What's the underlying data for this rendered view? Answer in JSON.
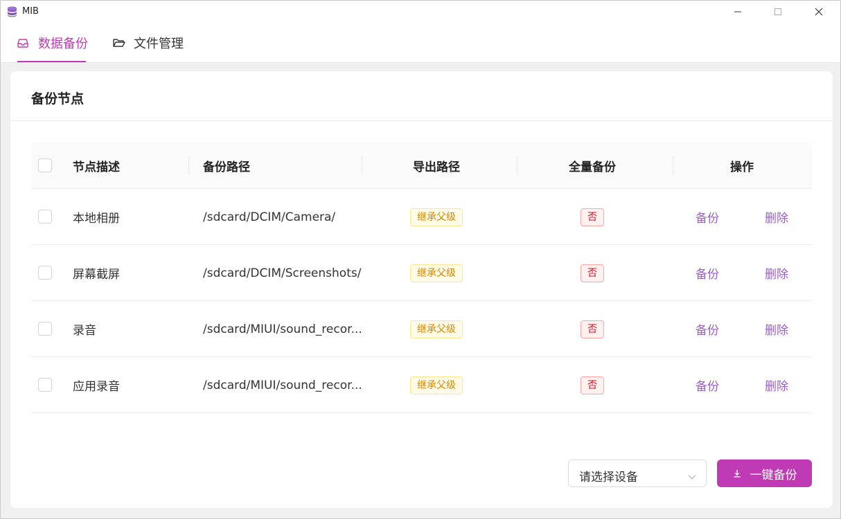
{
  "window": {
    "title": "MIB",
    "app_icon": "database-icon",
    "controls": {
      "minimize": "minimize-icon",
      "maximize": "maximize-icon",
      "close": "close-icon"
    }
  },
  "tabs": [
    {
      "label": "数据备份",
      "icon": "inbox-icon",
      "active": true
    },
    {
      "label": "文件管理",
      "icon": "folder-open-icon",
      "active": false
    }
  ],
  "card": {
    "title": "备份节点"
  },
  "table": {
    "columns": [
      "节点描述",
      "备份路径",
      "导出路径",
      "全量备份",
      "操作"
    ],
    "rows": [
      {
        "desc": "本地相册",
        "path": "/sdcard/DCIM/Camera/",
        "export": "继承父级",
        "full": "否",
        "op_backup": "备份",
        "op_delete": "删除"
      },
      {
        "desc": "屏幕截屏",
        "path": "/sdcard/DCIM/Screenshots/",
        "export": "继承父级",
        "full": "否",
        "op_backup": "备份",
        "op_delete": "删除"
      },
      {
        "desc": "录音",
        "path": "/sdcard/MIUI/sound_recor...",
        "export": "继承父级",
        "full": "否",
        "op_backup": "备份",
        "op_delete": "删除"
      },
      {
        "desc": "应用录音",
        "path": "/sdcard/MIUI/sound_recor...",
        "export": "继承父级",
        "full": "否",
        "op_backup": "备份",
        "op_delete": "删除"
      }
    ]
  },
  "footer": {
    "device_select_placeholder": "请选择设备",
    "one_click_backup_label": "一键备份",
    "one_click_backup_icon": "download-icon"
  },
  "colors": {
    "accent": "#c03ab5",
    "link": "#9a5fc2",
    "tag_warning": "#d48806",
    "tag_error": "#cf1322"
  }
}
